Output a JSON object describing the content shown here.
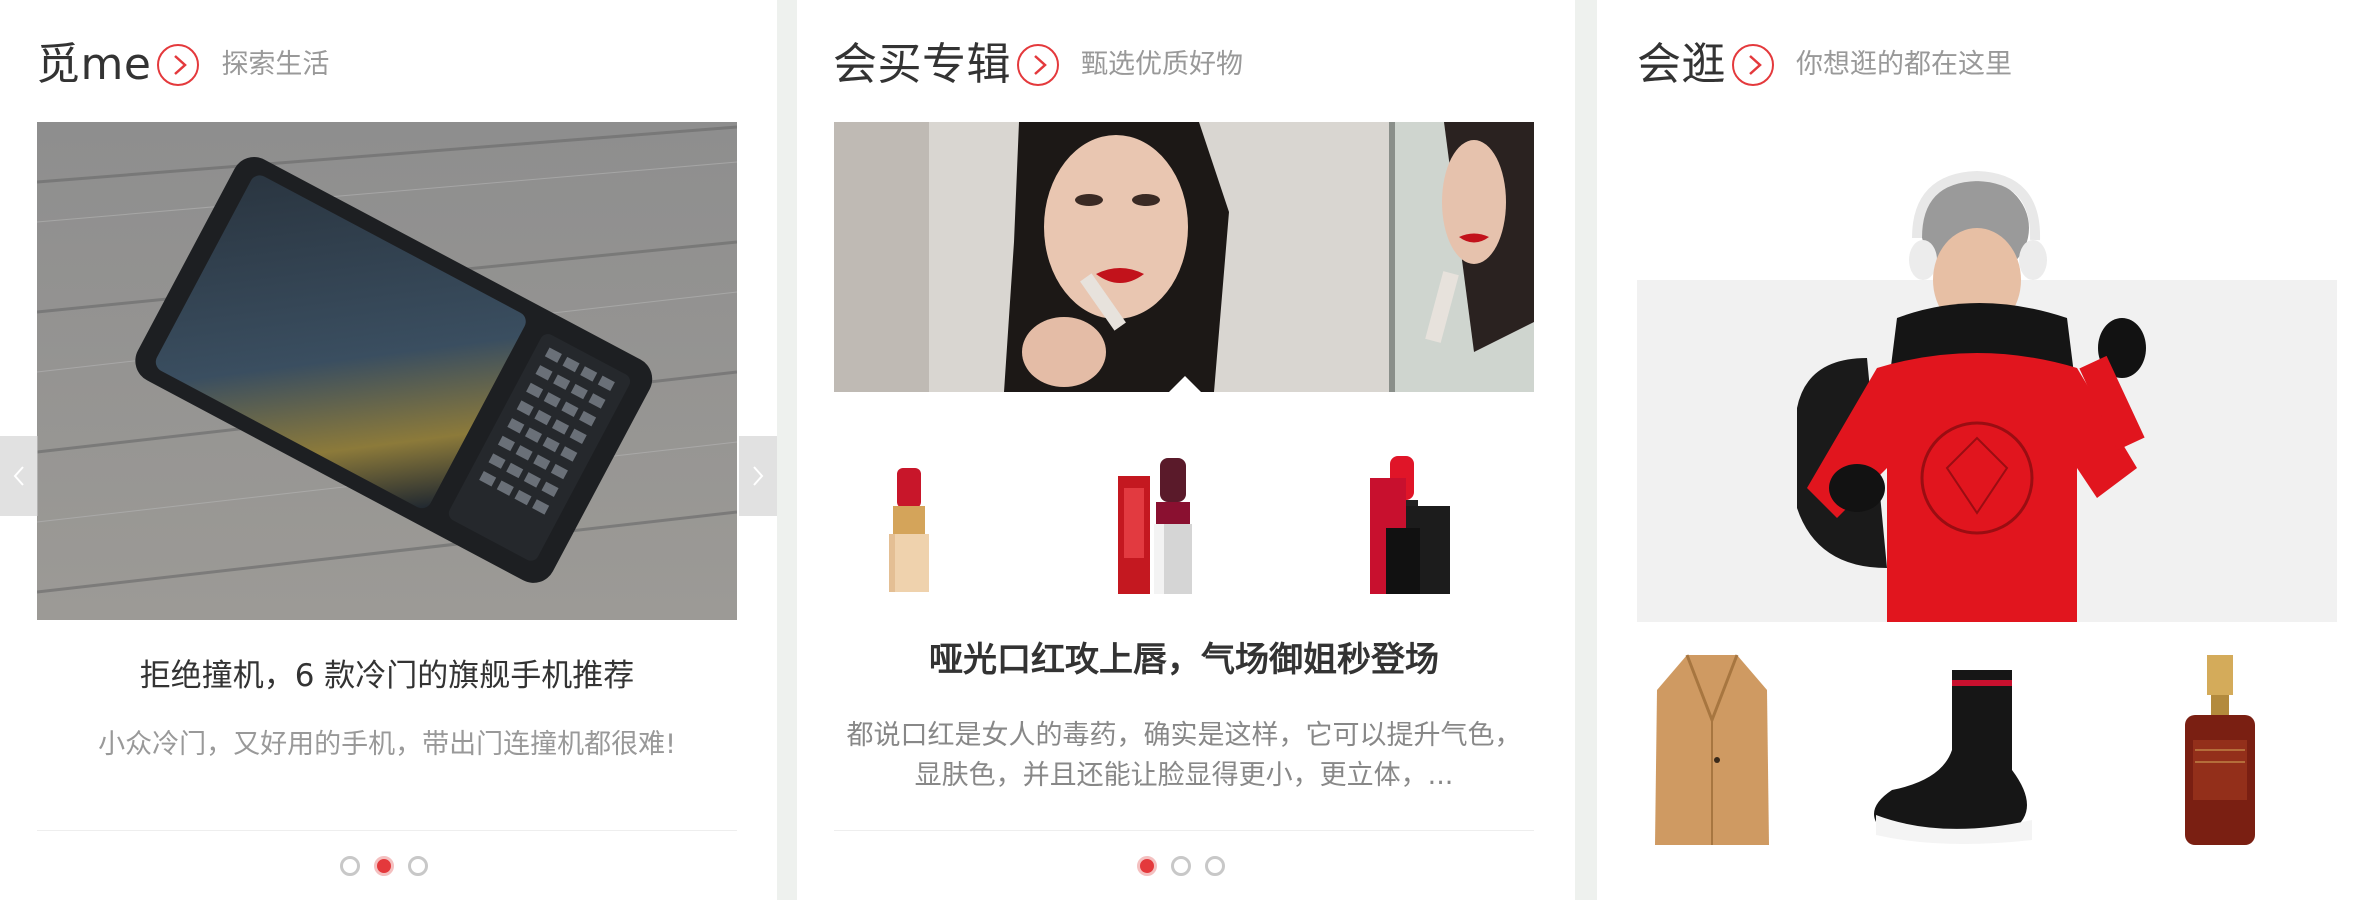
{
  "panel1": {
    "title": "觅me",
    "subtitle": "探索生活",
    "image": "blackberry-phone",
    "article_title": "拒绝撞机，6 款冷门的旗舰手机推荐",
    "article_desc": "小众冷门，又好用的手机，带出门连撞机都很难!",
    "active_dot": 2
  },
  "panel2": {
    "title": "会买专辑",
    "subtitle": "甄选优质好物",
    "banner_image": "woman-applying-lipstick",
    "products": [
      "lipstick-gold",
      "lipstick-red-box",
      "lipstick-black"
    ],
    "article_title": "哑光口红攻上唇，气场御姐秒登场",
    "article_desc_line1": "都说口红是女人的毒药，确实是这样，它可以提升气色，",
    "article_desc_line2": "显肤色，并且还能让脸显得更小，更立体，...",
    "active_dot": 1
  },
  "panel3": {
    "title": "会逛",
    "subtitle": "你想逛的都在这里",
    "hero_image": "man-red-sweater",
    "products": [
      "camel-coat",
      "sock-sneaker",
      "serum-bottle"
    ]
  },
  "colors": {
    "accent": "#e4393c",
    "muted": "#999999",
    "background": "#eef1ee"
  }
}
